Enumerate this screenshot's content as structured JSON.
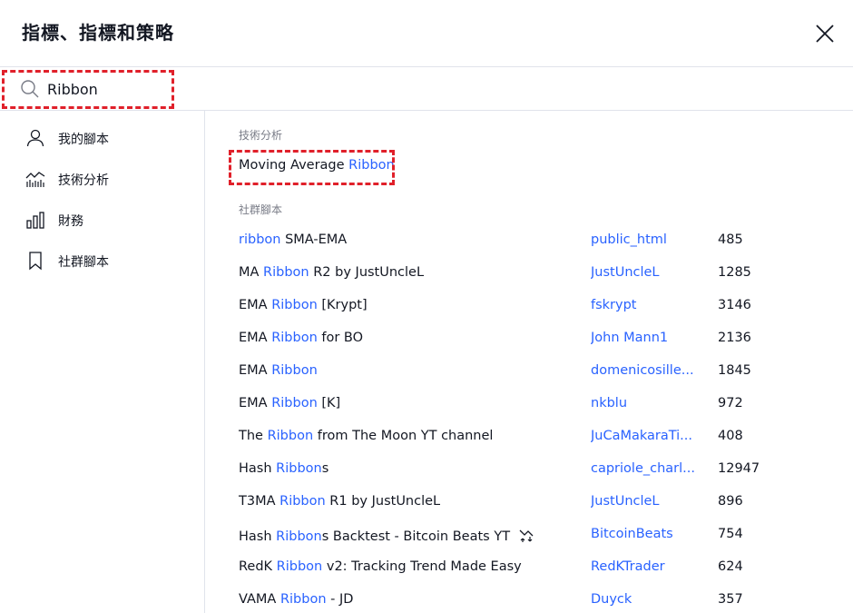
{
  "header": {
    "title": "指標、指標和策略"
  },
  "search": {
    "value": "Ribbon",
    "placeholder": ""
  },
  "sidebar": {
    "items": [
      {
        "label": "我的腳本",
        "icon": "user-icon"
      },
      {
        "label": "技術分析",
        "icon": "chart-line-icon"
      },
      {
        "label": "財務",
        "icon": "bar-chart-icon"
      },
      {
        "label": "社群腳本",
        "icon": "bookmark-icon"
      }
    ]
  },
  "main": {
    "technical": {
      "title": "技術分析",
      "item": {
        "pre": "Moving Average ",
        "match": "Ribbon",
        "post": ""
      }
    },
    "community": {
      "title": "社群腳本",
      "rows": [
        {
          "pre": "",
          "match": "ribbon",
          "post": " SMA-EMA",
          "author": "public_html",
          "count": "485"
        },
        {
          "pre": "MA ",
          "match": "Ribbon",
          "post": " R2 by JustUncleL",
          "author": "JustUncleL",
          "count": "1285"
        },
        {
          "pre": "EMA ",
          "match": "Ribbon",
          "post": " [Krypt]",
          "author": "fskrypt",
          "count": "3146"
        },
        {
          "pre": "EMA ",
          "match": "Ribbon",
          "post": " for BO",
          "author": "John Mann1",
          "count": "2136"
        },
        {
          "pre": "EMA ",
          "match": "Ribbon",
          "post": "",
          "author": "domenicosille...",
          "count": "1845"
        },
        {
          "pre": "EMA ",
          "match": "Ribbon",
          "post": " [K]",
          "author": "nkblu",
          "count": "972"
        },
        {
          "pre": "The ",
          "match": "Ribbon",
          "post": " from The Moon YT channel",
          "author": "JuCaMakaraTi...",
          "count": "408"
        },
        {
          "pre": "Hash ",
          "match": "Ribbon",
          "post": "s",
          "author": "capriole_charl...",
          "count": "12947"
        },
        {
          "pre": "T3MA ",
          "match": "Ribbon",
          "post": " R1 by JustUncleL",
          "author": "JustUncleL",
          "count": "896"
        },
        {
          "pre": "Hash ",
          "match": "Ribbon",
          "post": "s Backtest - Bitcoin Beats YT",
          "author": "BitcoinBeats",
          "count": "754",
          "icon": "strategy-icon"
        },
        {
          "pre": "RedK ",
          "match": "Ribbon",
          "post": " v2: Tracking Trend Made Easy",
          "author": "RedKTrader",
          "count": "624"
        },
        {
          "pre": "VAMA ",
          "match": "Ribbon",
          "post": " - JD",
          "author": "Duyck",
          "count": "357"
        }
      ]
    }
  },
  "colors": {
    "accent": "#2962ff",
    "highlight_border": "#e0202a",
    "text": "#131722",
    "muted": "#787b86"
  }
}
